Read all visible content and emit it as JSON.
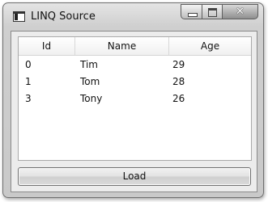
{
  "window": {
    "title": "LINQ Source",
    "controls": {
      "minimize_icon": "minimize-icon",
      "maximize_icon": "maximize-icon",
      "close_icon": "close-icon",
      "close_glyph": "✕"
    }
  },
  "grid": {
    "columns": [
      "Id",
      "Name",
      "Age"
    ],
    "rows": [
      {
        "id": "0",
        "name": "Tim",
        "age": "29"
      },
      {
        "id": "1",
        "name": "Tom",
        "age": "28"
      },
      {
        "id": "3",
        "name": "Tony",
        "age": "26"
      }
    ]
  },
  "load_button": {
    "label": "Load"
  }
}
